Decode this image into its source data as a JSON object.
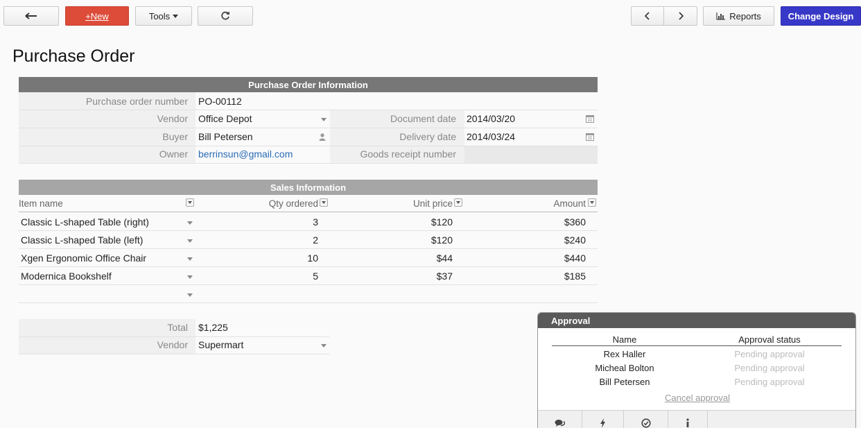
{
  "toolbar": {
    "new_label": "New",
    "new_prefix": "+",
    "tools_label": "Tools",
    "reports_label": "Reports",
    "change_design_label": "Change Design"
  },
  "page": {
    "title": "Purchase Order"
  },
  "po_info": {
    "header": "Purchase Order Information",
    "po_number_label": "Purchase order number",
    "po_number": "PO-00112",
    "vendor_label": "Vendor",
    "vendor": "Office Depot",
    "document_date_label": "Document date",
    "document_date": "2014/03/20",
    "buyer_label": "Buyer",
    "buyer": "Bill Petersen",
    "delivery_date_label": "Delivery date",
    "delivery_date": "2014/03/24",
    "owner_label": "Owner",
    "owner": "berrinsun@gmail.com",
    "goods_receipt_label": "Goods receipt number",
    "goods_receipt": ""
  },
  "sales": {
    "header": "Sales Information",
    "columns": [
      "Item name",
      "Qty ordered",
      "Unit price",
      "Amount"
    ],
    "rows": [
      {
        "item": "Classic L-shaped Table (right)",
        "qty": "3",
        "price": "$120",
        "amount": "$360"
      },
      {
        "item": "Classic L-shaped Table (left)",
        "qty": "2",
        "price": "$120",
        "amount": "$240"
      },
      {
        "item": "Xgen Ergonomic Office Chair",
        "qty": "10",
        "price": "$44",
        "amount": "$440"
      },
      {
        "item": "Modernica Bookshelf",
        "qty": "5",
        "price": "$37",
        "amount": "$185"
      }
    ]
  },
  "totals": {
    "total_label": "Total",
    "total": "$1,225",
    "vendor_label": "Vendor",
    "vendor": "Supermart"
  },
  "approval": {
    "header": "Approval",
    "name_col": "Name",
    "status_col": "Approval status",
    "rows": [
      {
        "name": "Rex Haller",
        "status": "Pending approval"
      },
      {
        "name": "Micheal Bolton",
        "status": "Pending approval"
      },
      {
        "name": "Bill Petersen",
        "status": "Pending approval"
      }
    ],
    "cancel_label": "Cancel approval"
  },
  "icons": {
    "back": "arrow-left-icon",
    "refresh": "refresh-icon",
    "prev": "chevron-left-icon",
    "next": "chevron-right-icon",
    "reports": "bar-chart-icon",
    "calendar": "calendar-icon",
    "user": "user-icon"
  },
  "colors": {
    "new_button": "#dd4b39",
    "change_design_button": "#3838c8",
    "po_header": "#777777",
    "sales_header": "#a6a6a6",
    "approval_header": "#5a5a5a",
    "link": "#2a6bb5"
  }
}
